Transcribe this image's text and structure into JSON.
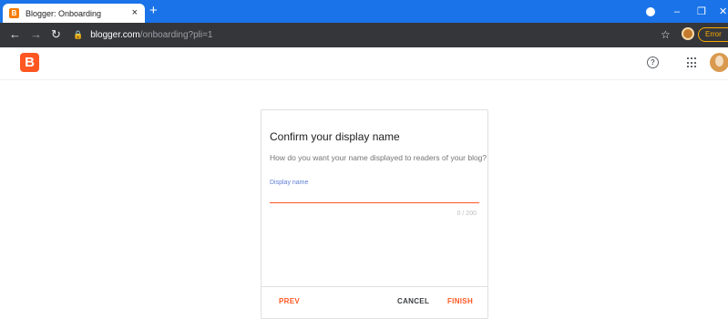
{
  "browser": {
    "tab_title": "Blogger: Onboarding",
    "tab_favicon_letter": "B",
    "close_glyph": "×",
    "new_tab_glyph": "+",
    "window_controls": {
      "minimize": "–",
      "restore": "❐",
      "close": "✕"
    },
    "url_host": "blogger.com",
    "url_path": "/onboarding?pli=1",
    "error_chip": "Error"
  },
  "app": {
    "logo_letter": "B",
    "help_glyph": "?"
  },
  "dialog": {
    "title": "Confirm your display name",
    "description": "How do you want your name displayed to readers of your blog?",
    "field_label": "Display name",
    "field_value": "",
    "char_count": "0 / 200",
    "prev_label": "PREV",
    "cancel_label": "CANCEL",
    "finish_label": "FINISH"
  },
  "colors": {
    "accent": "#ff5722",
    "chrome_titlebar": "#1a73e8",
    "chrome_toolbar": "#35363a",
    "label_blue": "#5f7fd6"
  },
  "icons": [
    "back-arrow-icon",
    "forward-arrow-icon",
    "reload-icon",
    "lock-icon",
    "star-icon",
    "help-icon",
    "apps-grid-icon"
  ]
}
